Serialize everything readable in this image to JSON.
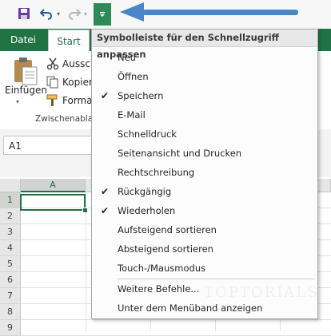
{
  "qat": {
    "undo_dropdown": "▾",
    "redo_dropdown": "▾",
    "customize_glyph": "▾",
    "arrow_color": "#4a86c7"
  },
  "ribbon": {
    "tabs": [
      {
        "label": "Datei"
      },
      {
        "label": "Start"
      }
    ],
    "paste_label": "Einfügen",
    "paste_dropdown": "▾",
    "commands": [
      {
        "label": "Ausschneiden",
        "icon": "scissors-icon"
      },
      {
        "label": "Kopieren",
        "icon": "copy-icon"
      },
      {
        "label": "Format übertragen",
        "icon": "format-painter-icon"
      }
    ],
    "group_label": "Zwischenablage",
    "accent": "#217346"
  },
  "namebox": {
    "value": "A1"
  },
  "grid": {
    "columns": [
      "A"
    ],
    "rows": [
      "1",
      "2",
      "3",
      "4",
      "5",
      "6",
      "7",
      "8",
      "9"
    ]
  },
  "menu": {
    "title": "Symbolleiste für den Schnellzugriff anpassen",
    "items": [
      {
        "label": "Neu",
        "checked": false
      },
      {
        "label": "Öffnen",
        "checked": false
      },
      {
        "label": "Speichern",
        "checked": true
      },
      {
        "label": "E-Mail",
        "checked": false
      },
      {
        "label": "Schnelldruck",
        "checked": false
      },
      {
        "label": "Seitenansicht und Drucken",
        "checked": false
      },
      {
        "label": "Rechtschreibung",
        "checked": false
      },
      {
        "label": "Rückgängig",
        "checked": true
      },
      {
        "label": "Wiederholen",
        "checked": true
      },
      {
        "label": "Aufsteigend sortieren",
        "checked": false
      },
      {
        "label": "Absteigend sortieren",
        "checked": false
      },
      {
        "label": "Touch-/Mausmodus",
        "checked": false
      },
      {
        "label": "Weitere Befehle...",
        "checked": false
      },
      {
        "label": "Unter dem Menüband anzeigen",
        "checked": false
      }
    ],
    "check_glyph": "✔",
    "watermark": "TOPTORIALS"
  }
}
